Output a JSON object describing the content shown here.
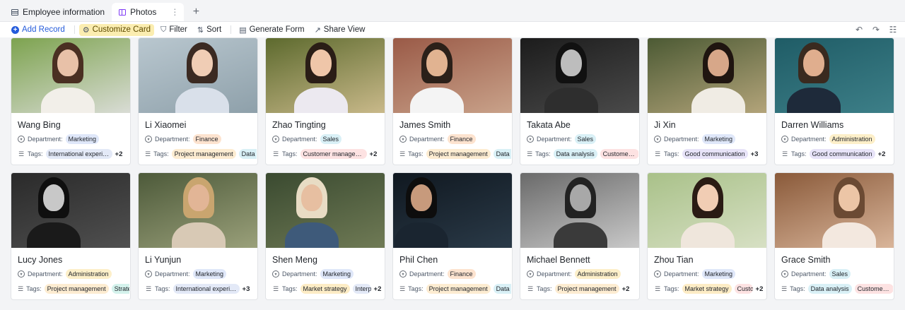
{
  "tabs": [
    {
      "label": "Employee information",
      "icon": "table-icon",
      "active": false
    },
    {
      "label": "Photos",
      "icon": "gallery-icon",
      "active": true
    }
  ],
  "toolbar": {
    "add_record": "Add Record",
    "customize_card": "Customize Card",
    "filter": "Filter",
    "sort": "Sort",
    "generate_form": "Generate Form",
    "share_view": "Share View"
  },
  "field_labels": {
    "department": "Department:",
    "tags": "Tags:"
  },
  "colors": {
    "Marketing": "#dfe7f9",
    "Finance": "#fde3cf",
    "Sales": "#d9f0f6",
    "Administration": "#fdefc9",
    "International experience": "#e3e9f7",
    "Project management": "#fdecd1",
    "Customer management": "#fde2e2",
    "Data analysis": "#d9f0f6",
    "Good communication": "#e7e3f8",
    "Market strategy": "#fdecc5",
    "Strategy": "#d4f2ec",
    "Interpersonal": "#e3e9f7",
    "Customer service": "#fde2e2"
  },
  "cards": [
    {
      "name": "Wang Bing",
      "department": "Marketing",
      "tags": [
        "International experience"
      ],
      "more": "+2",
      "photo": {
        "bg": [
          "#7da34f",
          "#d9dcd5"
        ],
        "skin": "#e8c1a8",
        "hair": "#4a2f22",
        "cloth": "#f2efe9",
        "hx": 80
      }
    },
    {
      "name": "Li Xiaomei",
      "department": "Finance",
      "tags": [
        "Project management",
        "Data analysis"
      ],
      "more": "",
      "photo": {
        "bg": [
          "#b9c7cf",
          "#8ea0aa"
        ],
        "skin": "#f0cdb5",
        "hair": "#3b2a22",
        "cloth": "#d9e0ea",
        "hx": 90
      }
    },
    {
      "name": "Zhao Tingting",
      "department": "Sales",
      "tags": [
        "Customer management"
      ],
      "more": "+2",
      "photo": {
        "bg": [
          "#5d6a2e",
          "#c9b98a"
        ],
        "skin": "#efc6a9",
        "hair": "#2a1d16",
        "cloth": "#ece9f0",
        "hx": 78
      }
    },
    {
      "name": "James Smith",
      "department": "Finance",
      "tags": [
        "Project management",
        "Data analysis"
      ],
      "more": "",
      "photo": {
        "bg": [
          "#9a5a47",
          "#c9a28a"
        ],
        "skin": "#e1b391",
        "hair": "#2b2019",
        "cloth": "#f4f4f4",
        "hx": 62
      }
    },
    {
      "name": "Takata Abe",
      "department": "Sales",
      "tags": [
        "Data analysis",
        "Customer management"
      ],
      "more": "",
      "photo": {
        "bg": [
          "#1c1c1c",
          "#4a4a4a"
        ],
        "skin": "#bdbdbd",
        "hair": "#111111",
        "cloth": "#2e2e2e",
        "hx": 72
      }
    },
    {
      "name": "Ji Xin",
      "department": "Marketing",
      "tags": [
        "Good communication"
      ],
      "more": "+3",
      "photo": {
        "bg": [
          "#4c5a34",
          "#b3a47a"
        ],
        "skin": "#d7a789",
        "hair": "#1f1510",
        "cloth": "#f0ece4",
        "hx": 100
      }
    },
    {
      "name": "Darren Williams",
      "department": "Administration",
      "tags": [
        "Good communication"
      ],
      "more": "+2",
      "photo": {
        "bg": [
          "#1f5c66",
          "#3d7f88"
        ],
        "skin": "#e0ae8e",
        "hair": "#3a2a1f",
        "cloth": "#1e2a3a",
        "hx": 55
      }
    },
    {
      "name": "Lucy Jones",
      "department": "Administration",
      "tags": [
        "Project management",
        "Strategy"
      ],
      "more": "",
      "photo": {
        "bg": [
          "#2a2a2a",
          "#505050"
        ],
        "skin": "#c8c8c8",
        "hair": "#0f0f0f",
        "cloth": "#1a1a1a",
        "hx": 60
      }
    },
    {
      "name": "Li Yunjun",
      "department": "Marketing",
      "tags": [
        "International experience"
      ],
      "more": "+3",
      "photo": {
        "bg": [
          "#4d5a3a",
          "#9aa07a"
        ],
        "skin": "#e2b596",
        "hair": "#c9a56f",
        "cloth": "#d8c9b5",
        "hx": 85
      }
    },
    {
      "name": "Shen Meng",
      "department": "Marketing",
      "tags": [
        "Market strategy",
        "Interpersonal"
      ],
      "more": "+2",
      "photo": {
        "bg": [
          "#3a4a30",
          "#6f7a55"
        ],
        "skin": "#e7bfa1",
        "hair": "#e8dcc4",
        "cloth": "#3e5a7a",
        "hx": 65
      }
    },
    {
      "name": "Phil Chen",
      "department": "Finance",
      "tags": [
        "Project management",
        "Data analysis"
      ],
      "more": "",
      "photo": {
        "bg": [
          "#101820",
          "#2a3a48"
        ],
        "skin": "#c79a7c",
        "hair": "#0d0d0d",
        "cloth": "#1a2530",
        "hx": 40
      }
    },
    {
      "name": "Michael Bennett",
      "department": "Administration",
      "tags": [
        "Project management"
      ],
      "more": "+2",
      "photo": {
        "bg": [
          "#6a6a6a",
          "#c9c9c9"
        ],
        "skin": "#a8a8a8",
        "hair": "#222222",
        "cloth": "#3a3a3a",
        "hx": 85
      }
    },
    {
      "name": "Zhou Tian",
      "department": "Marketing",
      "tags": [
        "Market strategy",
        "Customer service"
      ],
      "more": "+2",
      "photo": {
        "bg": [
          "#a9c189",
          "#d7e0c4"
        ],
        "skin": "#f1cdb4",
        "hair": "#2a1b14",
        "cloth": "#efe6dc",
        "hx": 85
      }
    },
    {
      "name": "Grace Smith",
      "department": "Sales",
      "tags": [
        "Data analysis",
        "Customer service"
      ],
      "more": "",
      "photo": {
        "bg": [
          "#8a5a3a",
          "#d9b59a"
        ],
        "skin": "#ecc5a6",
        "hair": "#6b4a33",
        "cloth": "#f3e8df",
        "hx": 105
      }
    }
  ]
}
